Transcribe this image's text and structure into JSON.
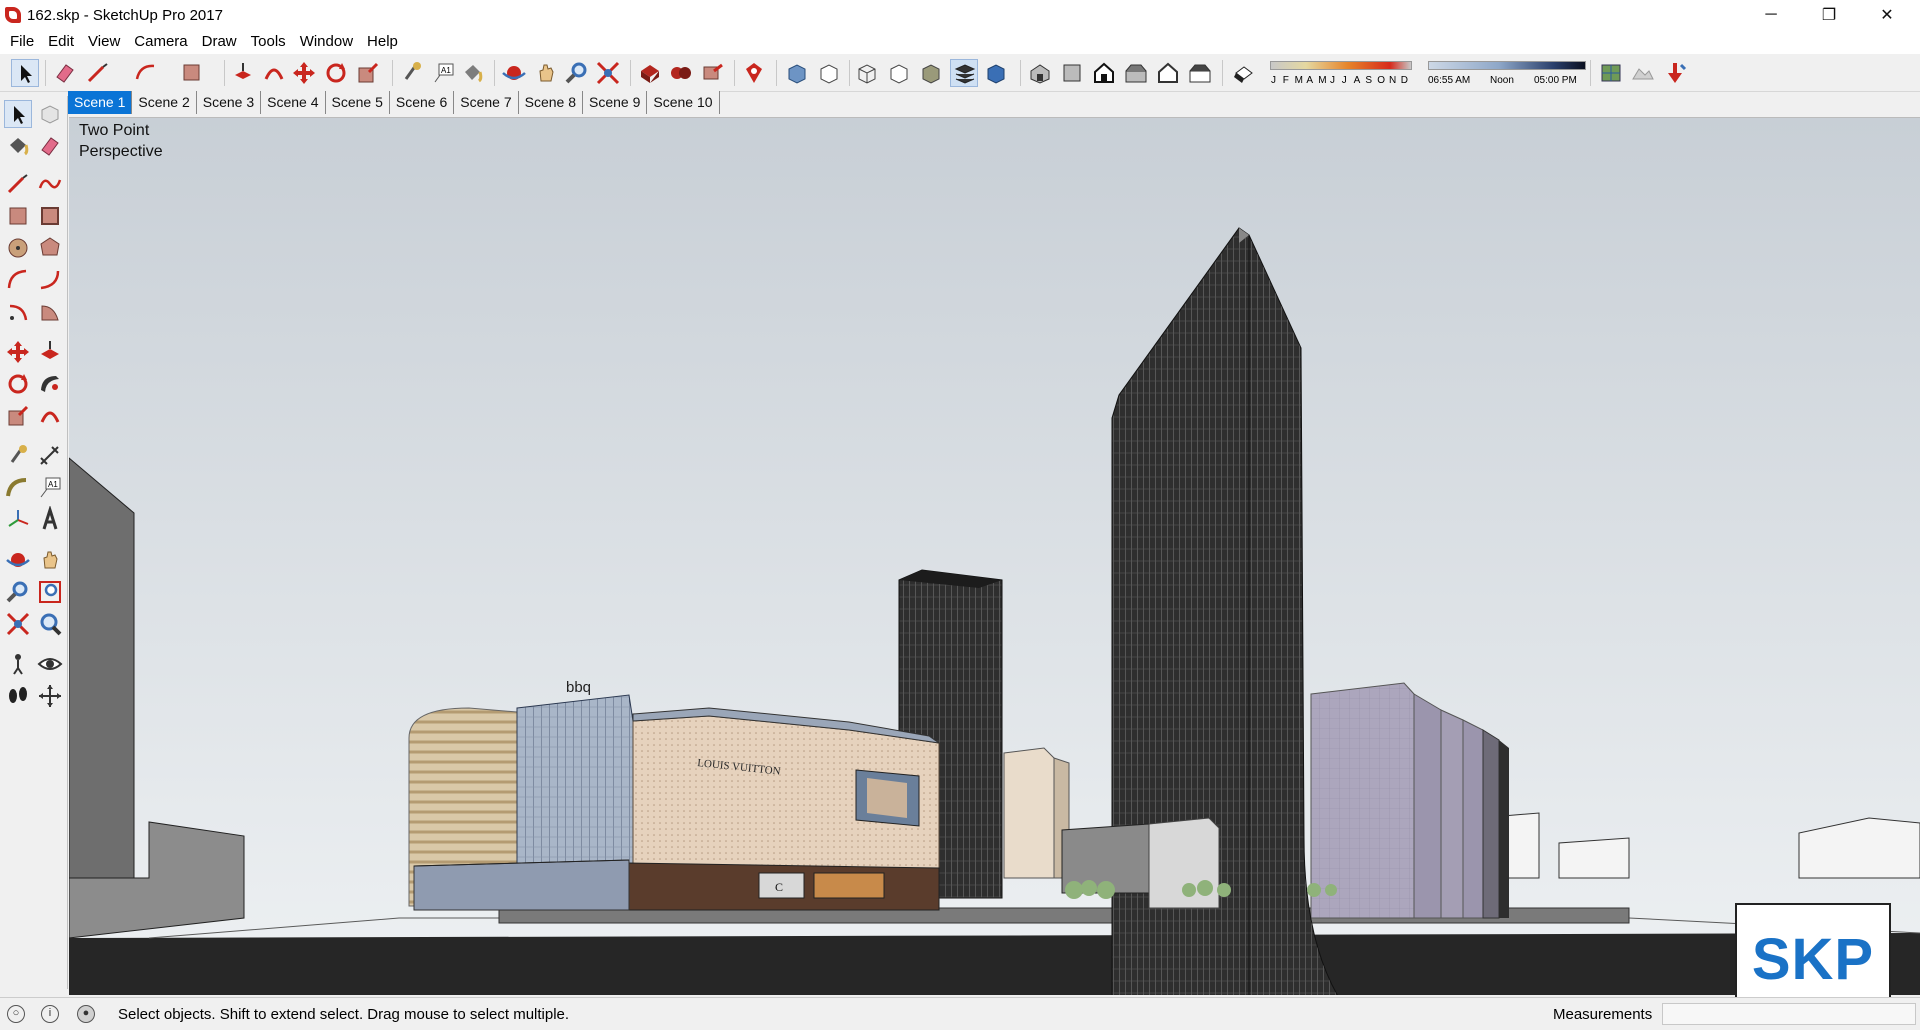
{
  "window": {
    "title": "162.skp - SketchUp Pro 2017",
    "minimize_glyph": "─",
    "maximize_glyph": "❐",
    "close_glyph": "✕"
  },
  "menu": [
    "File",
    "Edit",
    "View",
    "Camera",
    "Draw",
    "Tools",
    "Window",
    "Help"
  ],
  "toolbar": {
    "shadow_months": [
      "J",
      "F",
      "M",
      "A",
      "M",
      "J",
      "J",
      "A",
      "S",
      "O",
      "N",
      "D"
    ],
    "shadow_times": {
      "start": "06:55 AM",
      "mid": "Noon",
      "end": "05:00 PM"
    }
  },
  "scenes": {
    "active": "Scene 1",
    "tabs": [
      "Scene 1",
      "Scene 2",
      "Scene 3",
      "Scene 4",
      "Scene 5",
      "Scene 6",
      "Scene 7",
      "Scene 8",
      "Scene 9",
      "Scene 10"
    ]
  },
  "viewport": {
    "camera_label": "Two Point\nPerspective",
    "signage": {
      "bbq": "bbq",
      "lv": "LOUIS VUITTON",
      "chanel": "C"
    },
    "colors": {
      "sky_top": "#c8cfd6",
      "sky_bottom": "#eef1f3",
      "ground": "#262626"
    }
  },
  "status": {
    "text": "Select objects. Shift to extend select. Drag mouse to select multiple.",
    "measurements_label": "Measurements"
  },
  "watermark": {
    "text": "SKP"
  },
  "accent": "#0a74d6"
}
